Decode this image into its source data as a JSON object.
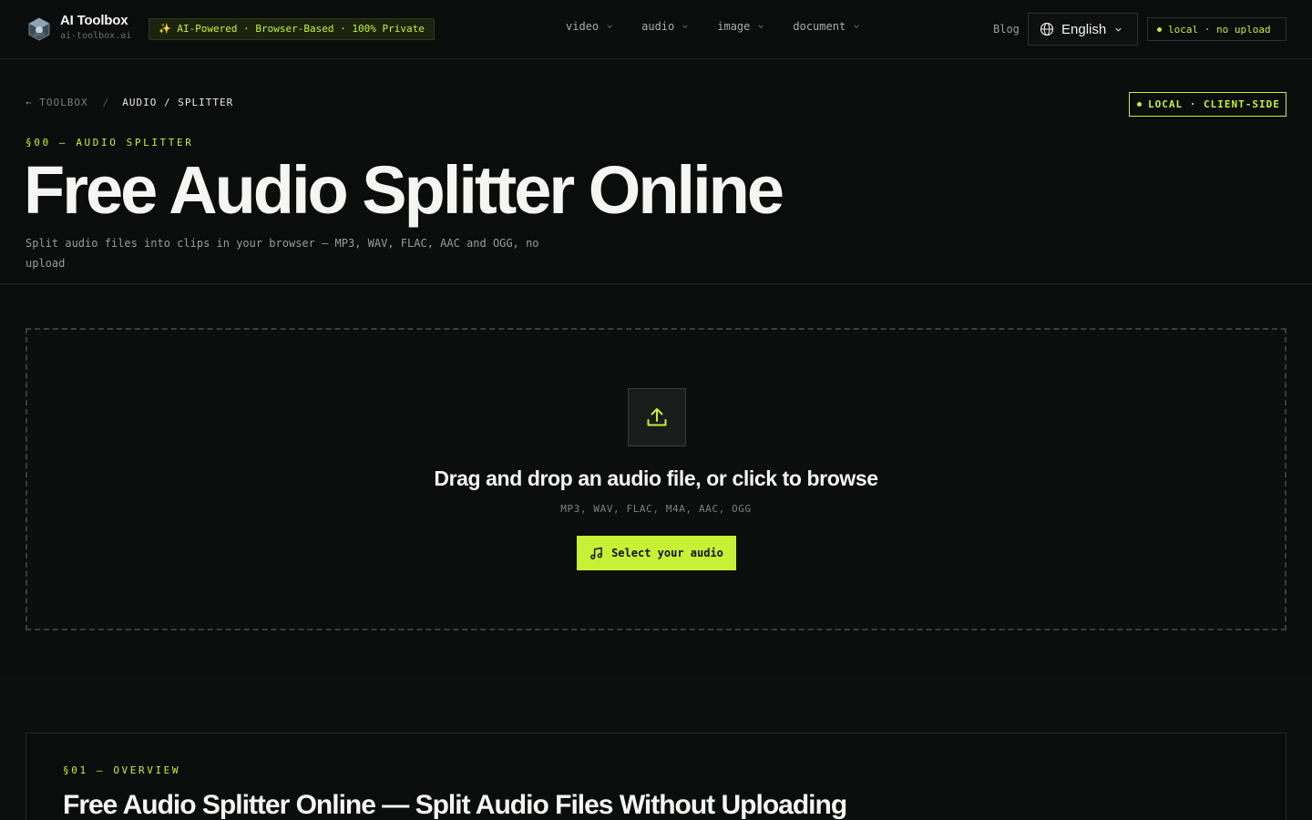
{
  "header": {
    "brand_name": "AI Toolbox",
    "brand_domain": "ai-toolbox.ai",
    "promo_badge": "✨ AI-Powered · Browser-Based · 100% Private",
    "nav": [
      {
        "label": "video",
        "icon": "chevron-down-icon"
      },
      {
        "label": "audio",
        "icon": "chevron-down-icon"
      },
      {
        "label": "image",
        "icon": "chevron-down-icon"
      },
      {
        "label": "document",
        "icon": "chevron-down-icon"
      }
    ],
    "blog_label": "Blog",
    "language": "English",
    "local_badge": "local · no upload"
  },
  "hero": {
    "breadcrumb_back": "← TOOLBOX",
    "breadcrumb_separator": "/",
    "breadcrumb_current": "AUDIO / SPLITTER",
    "client_badge": "LOCAL · CLIENT-SIDE",
    "section_tag": "§00 — AUDIO SPLITTER",
    "title": "Free Audio Splitter Online",
    "subtitle": "Split audio files into clips in your browser — MP3, WAV, FLAC, AAC and OGG, no upload"
  },
  "dropzone": {
    "heading": "Drag and drop an audio file, or click to browse",
    "formats": "MP3, WAV, FLAC, M4A, AAC, OGG",
    "button_label": "Select your audio",
    "upload_icon": "upload-icon",
    "button_icon": "music-note-icon"
  },
  "overview": {
    "tag": "§01 — OVERVIEW",
    "title": "Free Audio Splitter Online — Split Audio Files Without Uploading"
  },
  "colors": {
    "background": "#0b0c0c",
    "accent": "#c6f135",
    "text": "#f5f5f3",
    "muted": "#9a9d9c"
  }
}
